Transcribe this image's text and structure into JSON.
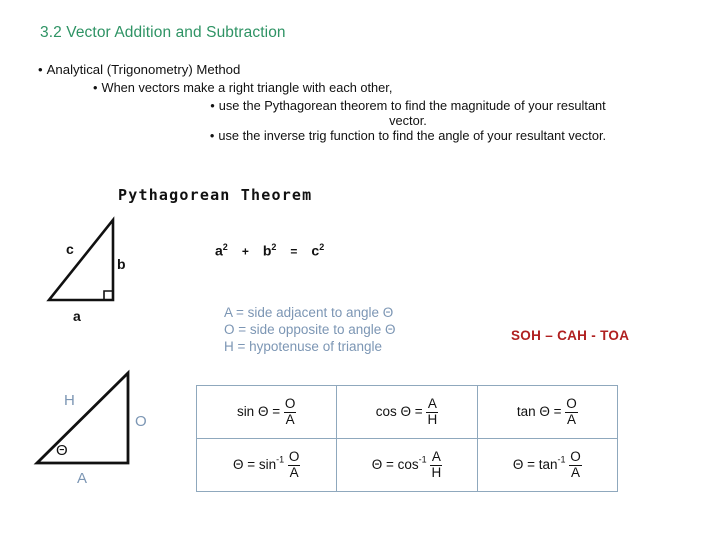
{
  "slide": {
    "title": "3.2 Vector Addition and Subtraction"
  },
  "bullets": {
    "level1": "Analytical (Trigonometry) Method",
    "level2": "When vectors make a right triangle with each other,",
    "level3_a_line1": "use the Pythagorean theorem to find the magnitude of your resultant",
    "level3_a_line2": "vector.",
    "level3_b": "use the inverse trig function to find the angle of your resultant vector.",
    "bullet_glyph": "•"
  },
  "pythagorean": {
    "heading": "Pythagorean Theorem",
    "equation": {
      "a": "a",
      "a_exp": "2",
      "plus": "+",
      "b": "b",
      "b_exp": "2",
      "equals": "=",
      "c": "c",
      "c_exp": "2",
      "full_text": "a2 + b2 = c2"
    },
    "triangle_labels": {
      "hypotenuse": "c",
      "vertical": "b",
      "base": "a"
    }
  },
  "definitions": {
    "line1": "A = side adjacent to angle Θ",
    "line2": "O = side opposite to angle Θ",
    "line3": "H = hypotenuse of triangle"
  },
  "mnemonic": {
    "text": "SOH – CAH - TOA",
    "color": "#b02020"
  },
  "trig_triangle": {
    "hypotenuse": "H",
    "opposite": "O",
    "adjacent": "A",
    "angle": "Θ"
  },
  "trig_table": {
    "rows": [
      [
        {
          "lead": "sin Θ =",
          "num": "O",
          "den": "A"
        },
        {
          "lead": "cos Θ =",
          "num": "A",
          "den": "H"
        },
        {
          "lead": "tan Θ =",
          "num": "O",
          "den": "A"
        }
      ],
      [
        {
          "lead": "Θ = sin",
          "exp": "-1",
          "num": "O",
          "den": "A"
        },
        {
          "lead": "Θ = cos",
          "exp": "-1",
          "num": "A",
          "den": "H"
        },
        {
          "lead": "Θ = tan",
          "exp": "-1",
          "num": "O",
          "den": "A"
        }
      ]
    ]
  },
  "colors": {
    "title_green": "#2e9364",
    "definition_blue": "#7c96b4",
    "mnemonic_red": "#b02020",
    "table_border": "#8fa8bd",
    "text_black": "#111111"
  }
}
